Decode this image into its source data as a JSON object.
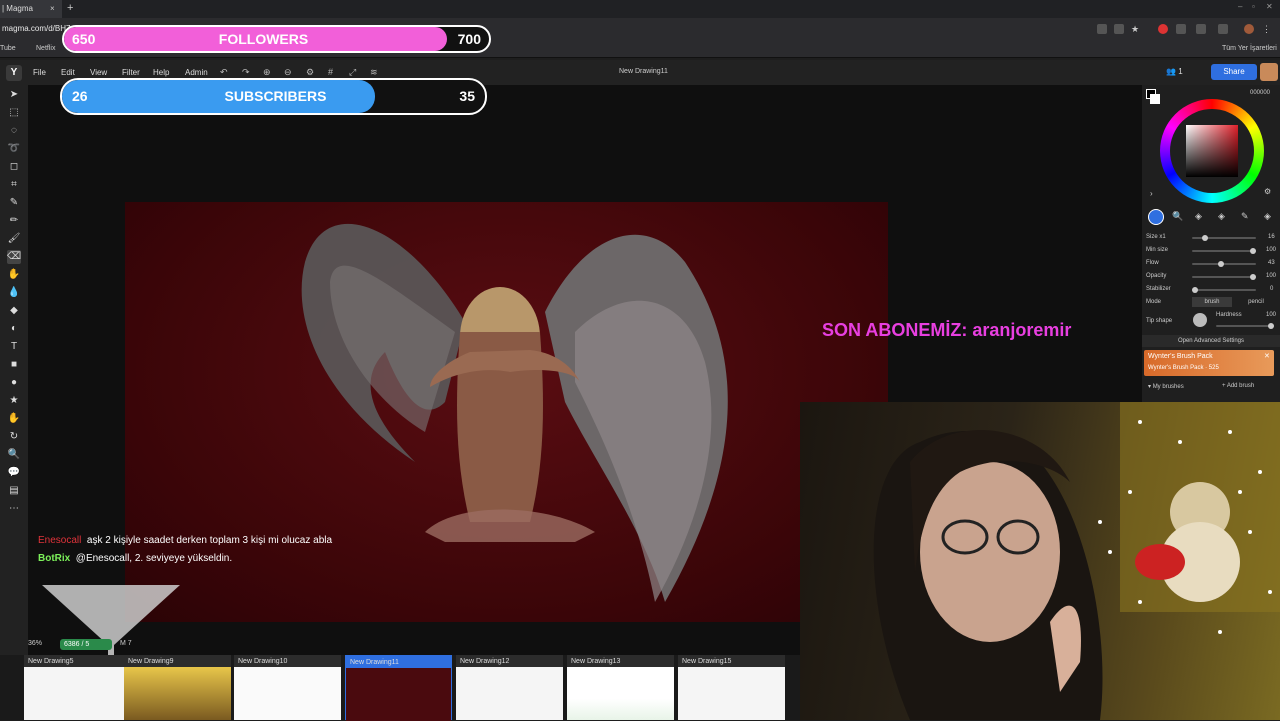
{
  "browser": {
    "tab_title": "| Magma",
    "tab_close": "×",
    "new_tab": "+",
    "url": "magma.com/d/BH7",
    "bookmarks": [
      "Tube",
      "Netflix"
    ],
    "all_bookmarks": "Tüm Yer İşaretleri",
    "window_controls": [
      "–",
      "▫",
      "✕"
    ]
  },
  "app": {
    "logo": "Y",
    "menu": [
      "File",
      "Edit",
      "View",
      "Filter",
      "Help",
      "Admin"
    ],
    "document_title": "New Drawing11",
    "users_count": "1",
    "share_label": "Share"
  },
  "right_panel": {
    "hex": "000000",
    "size_label": "Size x1",
    "size_value": "16",
    "min_size_label": "Min size",
    "min_size_value": "100",
    "flow_label": "Flow",
    "flow_value": "43",
    "opacity_label": "Opacity",
    "opacity_value": "100",
    "stabilizer_label": "Stabilizer",
    "stabilizer_value": "0",
    "mode_label": "Mode",
    "mode_brush": "brush",
    "mode_pencil": "pencil",
    "tip_shape_label": "Tip shape",
    "hardness_label": "Hardness",
    "hardness_value": "100",
    "advanced_settings": "Open Advanced Settings",
    "brush_pack_title": "Wynter's Brush Pack",
    "brush_pack_sub": "Wynter's Brush Pack · 525",
    "my_brushes": "My brushes",
    "add_brush": "Add brush"
  },
  "overlays": {
    "followers": {
      "current": "650",
      "label": "FOLLOWERS",
      "goal": "700",
      "progress": 0.9
    },
    "subscribers": {
      "current": "26",
      "label": "SUBSCRIBERS",
      "goal": "35",
      "progress": 0.74
    },
    "last_sub": "SON ABONEMİZ: aranjoremir"
  },
  "chat": [
    {
      "user": "Enesocall",
      "user_color": "#e0333a",
      "text": "aşk 2 kişiyle saadet derken toplam 3 kişi mi olucaz abla"
    },
    {
      "user": "BotRix",
      "user_color": "#7cf05a",
      "text": "@Enesocall, 2. seviyeye yükseldin."
    }
  ],
  "status": {
    "zoom": "36%",
    "coords": "6386 / 5",
    "layer_count": "M 7"
  },
  "drawings": [
    "New Drawing5",
    "New Drawing9",
    "New Drawing10",
    "New Drawing11",
    "New Drawing12",
    "New Drawing13",
    "New Drawing15"
  ],
  "colors": {
    "followers_fill": "#f25fd9",
    "subscribers_fill": "#3a9bf0",
    "accent": "#2f6fe0",
    "last_sub_color": "#e83fe0"
  }
}
